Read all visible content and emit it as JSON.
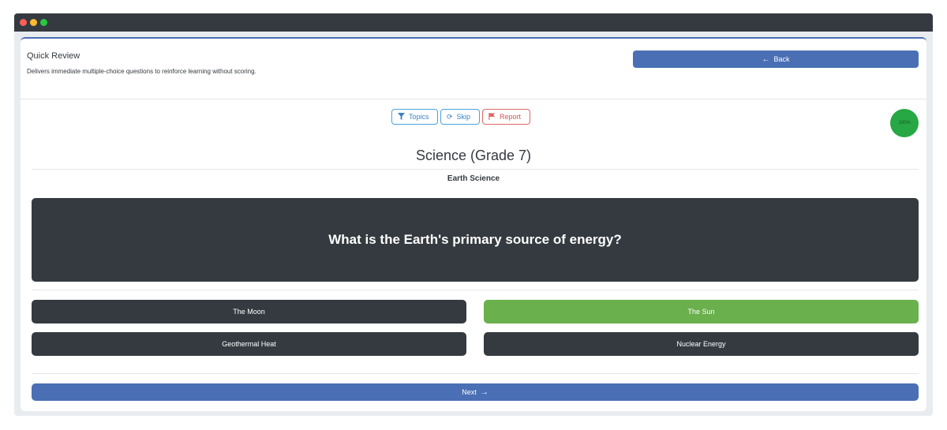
{
  "header": {
    "title": "Quick Review",
    "description": "Delivers immediate multiple-choice questions to reinforce learning without scoring.",
    "back_label": "Back"
  },
  "toolbar": {
    "topics_label": "Topics",
    "skip_label": "Skip",
    "report_label": "Report"
  },
  "progress": {
    "label": "100%",
    "value": 100
  },
  "quiz": {
    "subject": "Science (Grade 7)",
    "topic": "Earth Science",
    "question": "What is the Earth's primary source of energy?",
    "answers": [
      {
        "label": "The Moon",
        "state": "default"
      },
      {
        "label": "The Sun",
        "state": "correct"
      },
      {
        "label": "Geothermal Heat",
        "state": "default"
      },
      {
        "label": "Nuclear Energy",
        "state": "default"
      }
    ],
    "next_label": "Next"
  },
  "colors": {
    "primary": "#4a6fb5",
    "dark": "#343a40",
    "correct": "#6ab04c",
    "progress": "#28a745",
    "info": "#4aa3df",
    "danger": "#e06666"
  },
  "icons": {
    "back": "arrow-left-icon",
    "topics": "filter-icon",
    "skip": "refresh-icon",
    "report": "flag-icon",
    "next": "arrow-right-icon"
  }
}
